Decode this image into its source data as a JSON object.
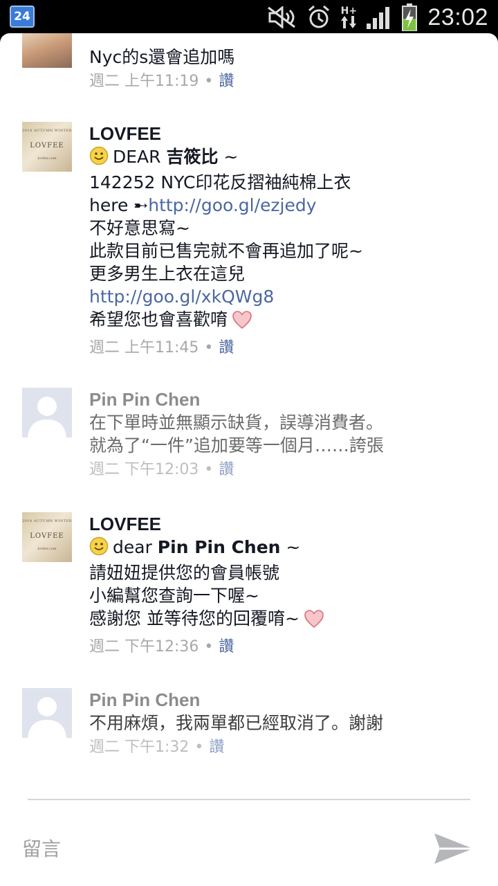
{
  "status_bar": {
    "calendar_day": "24",
    "time": "23:02",
    "network": "H+",
    "icons": [
      "calendar-icon",
      "mute-icon",
      "alarm-icon",
      "data-arrows-icon",
      "signal-icon",
      "battery-charging-icon"
    ]
  },
  "comments": [
    {
      "name": "",
      "lines": [
        "Nyc的s還會追加嗎"
      ],
      "time": "週二 上午11:19",
      "like": "讚"
    },
    {
      "name": "LOVFEE",
      "avatar_text": {
        "sub": "2014 AUTUMN WINTER",
        "brand": "LOVFEE",
        "sub2": "lovfee.com"
      },
      "greeting_prefix": "DEAR ",
      "greeting_name": "吉筱比",
      "greeting_suffix": " ~",
      "line2": "142252 NYC印花反摺袖純棉上衣",
      "line3_prefix": "here ➸",
      "line3_link": "http://goo.gl/ezjedy",
      "line4": "不好意思寫~",
      "line5": "此款目前已售完就不會再追加了呢~",
      "line6": "更多男生上衣在這兒",
      "line7_link": "http://goo.gl/xkQWg8",
      "line8": "希望您也會喜歡唷",
      "time": "週二 上午11:45",
      "like": "讚"
    },
    {
      "name": "Pin Pin Chen",
      "lines": [
        "在下單時並無顯示缺貨，誤導消費者。",
        "就為了“一件”追加要等一個月……誇張"
      ],
      "time": "週二 下午12:03",
      "like": "讚"
    },
    {
      "name": "LOVFEE",
      "avatar_text": {
        "sub": "2014 AUTUMN WINTER",
        "brand": "LOVFEE",
        "sub2": "lovfee.com"
      },
      "greeting_prefix": "dear ",
      "greeting_name": "Pin Pin Chen",
      "greeting_suffix": " ~",
      "line2": "請妞妞提供您的會員帳號",
      "line3": "小編幫您查詢一下喔~",
      "line4": "感謝您 並等待您的回覆唷~",
      "time": "週二 下午12:36",
      "like": "讚"
    },
    {
      "name": "Pin Pin Chen",
      "lines": [
        "不用麻煩，我兩單都已經取消了。謝謝"
      ],
      "time": "週二 下午1:32",
      "like": "讚"
    }
  ],
  "composer": {
    "placeholder": "留言",
    "send_icon": "send-icon"
  },
  "colors": {
    "link": "#4b67a1",
    "name": "#141823",
    "meta": "#a8a8a8",
    "heart": "#e8a0a8"
  }
}
